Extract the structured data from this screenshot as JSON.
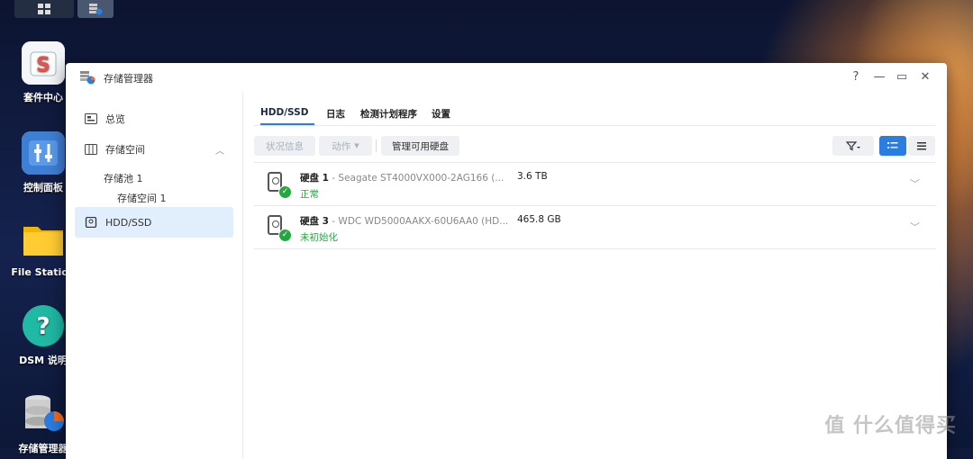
{
  "desktop": {
    "icons": [
      {
        "label": "套件中心"
      },
      {
        "label": "控制面板"
      },
      {
        "label": "File Station"
      },
      {
        "label": "DSM 说明"
      },
      {
        "label": "存储管理器"
      }
    ],
    "watermark": "值 什么值得买"
  },
  "window": {
    "title": "存储管理器",
    "controls": {
      "help": "?",
      "minimize": "—",
      "maximize": "▭",
      "close": "✕"
    }
  },
  "sidebar": {
    "overview": "总览",
    "storage_space": "存储空间",
    "storage_pool": "存储池 1",
    "volume": "存储空间 1",
    "hdd_ssd": "HDD/SSD"
  },
  "tabs": [
    "HDD/SSD",
    "日志",
    "检测计划程序",
    "设置"
  ],
  "toolbar": {
    "status_info": "状况信息",
    "action": "动作",
    "manage": "管理可用硬盘"
  },
  "disks": [
    {
      "name": "硬盘 1",
      "model": " - Seagate ST4000VX000-2AG166 (...",
      "size": "3.6 TB",
      "status": "正常"
    },
    {
      "name": "硬盘 3",
      "model": " - WDC WD5000AAKX-60U6AA0 (HD...",
      "size": "465.8 GB",
      "status": "未初始化"
    }
  ],
  "colors": {
    "accent": "#2a7de1",
    "ok": "#23a840",
    "active_nav": "#e1eefb"
  }
}
